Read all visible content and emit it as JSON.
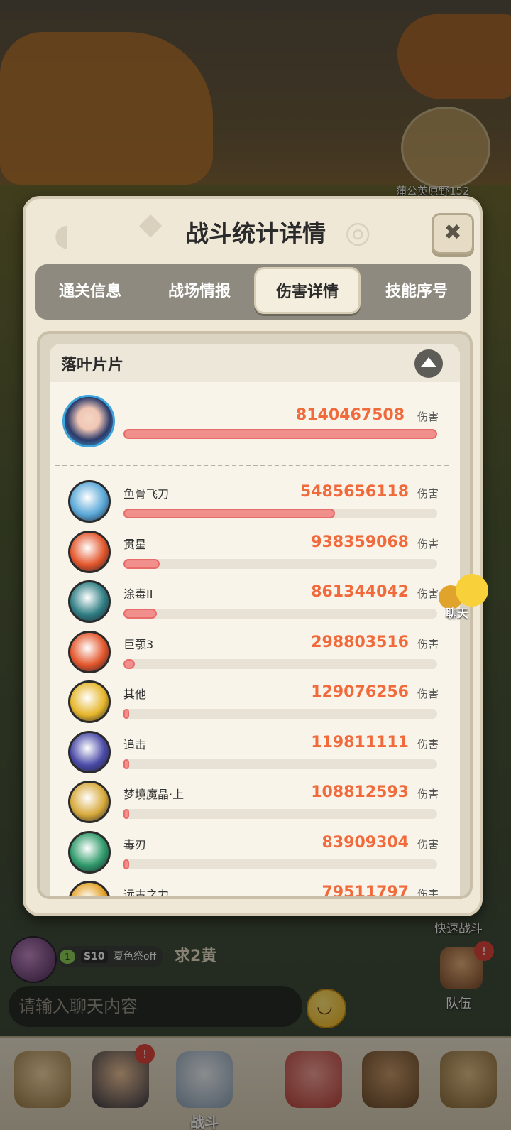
{
  "scene": {
    "map_label": "蒲公英原野152",
    "quick_battle": "快速战斗",
    "team_label": "队伍",
    "team_badge": "!",
    "chat_float_label": "聊天"
  },
  "chat": {
    "level": "1",
    "season": "S10",
    "event": "夏色祭off",
    "message": "求2黄",
    "input_placeholder": "请输入聊天内容"
  },
  "nav": {
    "battle_label": "战斗",
    "badge": "!"
  },
  "modal": {
    "title": "战斗统计详情",
    "close_symbol": "✖",
    "tabs": [
      {
        "label": "通关信息",
        "active": false
      },
      {
        "label": "战场情报",
        "active": false
      },
      {
        "label": "伤害详情",
        "active": true
      },
      {
        "label": "技能序号",
        "active": false
      }
    ]
  },
  "damage": {
    "player_name": "落叶片片",
    "unit": "伤害",
    "total": {
      "value": "8140467508",
      "fraction": 1.0
    },
    "skills": [
      {
        "name": "鱼骨飞刀",
        "value": "5485656118",
        "fraction": 0.674,
        "icon": "fishbone-blades-icon",
        "color": "#5aa8d8"
      },
      {
        "name": "贯星",
        "value": "938359068",
        "fraction": 0.115,
        "icon": "star-pierce-icon",
        "color": "#e3562b"
      },
      {
        "name": "涂毒II",
        "value": "861344042",
        "fraction": 0.106,
        "icon": "poison-drop-icon",
        "color": "#2f7e84"
      },
      {
        "name": "巨颚3",
        "value": "298803516",
        "fraction": 0.037,
        "icon": "giant-jaw-icon",
        "color": "#e3562b"
      },
      {
        "name": "其他",
        "value": "129076256",
        "fraction": 0.016,
        "icon": "gold-nugget-icon",
        "color": "#e6b62b"
      },
      {
        "name": "追击",
        "value": "119811111",
        "fraction": 0.015,
        "icon": "pursuit-icon",
        "color": "#4a4aa8"
      },
      {
        "name": "梦境魔晶·上",
        "value": "108812593",
        "fraction": 0.013,
        "icon": "dream-crystal-icon",
        "color": "#d7a93a"
      },
      {
        "name": "毒刃",
        "value": "83909304",
        "fraction": 0.01,
        "icon": "poison-blade-icon",
        "color": "#2f9a6a"
      },
      {
        "name": "远古之力",
        "value": "79511797",
        "fraction": 0.01,
        "icon": "ancient-power-icon",
        "color": "#e4a126"
      }
    ]
  }
}
